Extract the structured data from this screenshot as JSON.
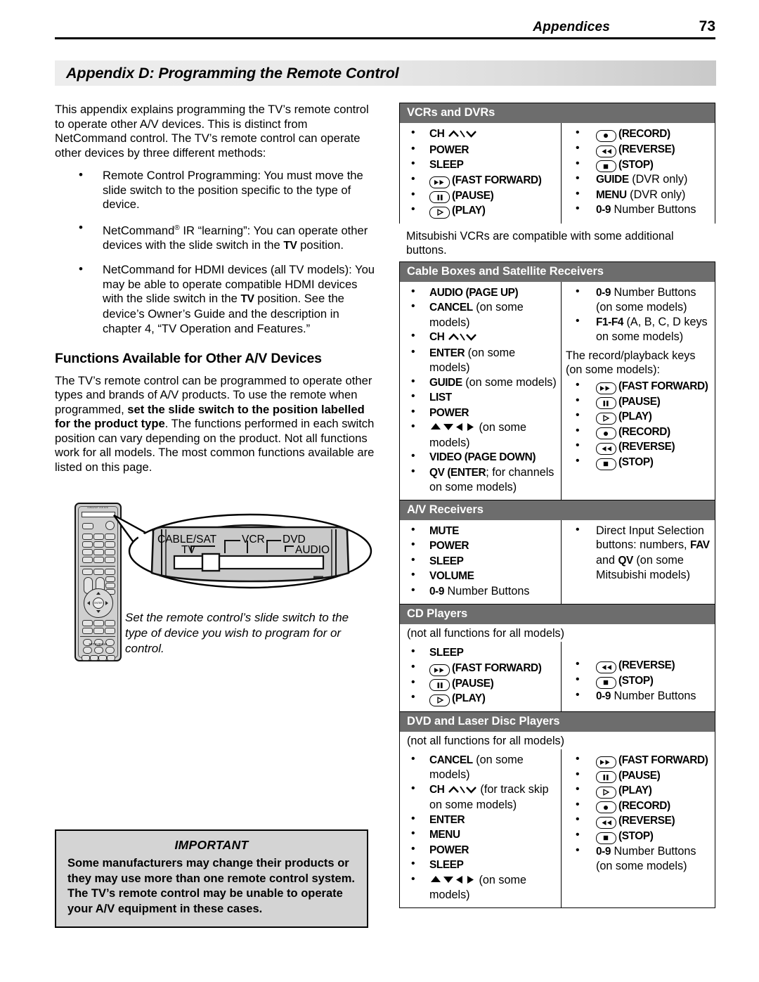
{
  "header": {
    "section_title": "Appendices",
    "page_number": "73"
  },
  "banner": {
    "title": "Appendix D:  Programming the Remote Control"
  },
  "left": {
    "intro": "This appendix explains programming the TV’s remote control to operate other A/V devices.  This is distinct from NetCommand control.  The TV’s remote control can operate other devices by three different methods:",
    "methods": [
      {
        "pre": "Remote Control Programming:  You must move the slide switch to the position specific to the type of device."
      },
      {
        "pre_a": "NetCommand",
        "reg": "®",
        "pre_b": " IR “learning”:  You can operate other devices with the slide switch in the ",
        "device": "TV",
        "post": " position."
      },
      {
        "pre_a": "NetCommand for HDMI devices (all TV models): You may be able to operate compatible HDMI devices with the slide switch in the ",
        "device": "TV",
        "post": " position. See the device’s Owner’s Guide and the description in chapter 4, “TV Operation and Features.”"
      }
    ],
    "section_heading": "Functions Available for Other A/V Devices",
    "para2_a": "The TV’s remote control can be programmed to operate other types and brands of A/V products.  To use the remote when programmed, ",
    "para2_bold": "set the slide switch to the position labelled for the product type",
    "para2_b": ".  The functions performed in each switch position can vary depending on the product.  Not all functions work for all models.  The most common functions available are listed on this page.",
    "figure": {
      "labels": {
        "cable_sat": "CABLE/SAT",
        "tv": "TV",
        "vcr": "VCR",
        "dvd": "DVD",
        "audio": "AUDIO"
      },
      "remote_slide_labels": "CABLE/SAT  VCR  DVD",
      "remote_slide_labels2": "TV  |  |  AUDIO",
      "remote_power_label": "POWER",
      "remote_brand": "MITSUBISHI",
      "caption": "Set the remote control’s slide switch to the type of device you wish to program for or control."
    },
    "important": {
      "title": "IMPORTANT",
      "body": "Some manufacturers may change their products or they may use more than one remote control system.  The TV’s remote control may be unable to operate your A/V equipment in these cases."
    }
  },
  "tables": [
    {
      "id": "vcrs-and-dvrs",
      "heading": "VCRs and DVRs",
      "col1": [
        {
          "label": "CH",
          "style": "cond",
          "suffix_icon": "ch-up-down"
        },
        {
          "label": "POWER",
          "style": "cond"
        },
        {
          "label": "SLEEP",
          "style": "cond"
        },
        {
          "icon": "fast-forward",
          "label": "(FAST FORWARD)",
          "style": "cond"
        },
        {
          "icon": "pause",
          "label": "(PAUSE)",
          "style": "cond"
        },
        {
          "icon": "play",
          "label": "(PLAY)",
          "style": "cond"
        }
      ],
      "col2": [
        {
          "icon": "record",
          "label": "(RECORD)",
          "style": "cond"
        },
        {
          "icon": "reverse",
          "label": "(REVERSE)",
          "style": "cond"
        },
        {
          "icon": "stop",
          "label": "(STOP)",
          "style": "cond"
        },
        {
          "label": "GUIDE",
          "style": "cond",
          "plain": " (DVR only)"
        },
        {
          "label": "MENU",
          "style": "cond",
          "plain": " (DVR only)"
        },
        {
          "label": "0-9",
          "style": "cond",
          "plain": " Number Buttons"
        }
      ],
      "footer_note": "Mitsubishi VCRs are compatible with some additional buttons."
    },
    {
      "id": "cable-boxes-and-satellite-receivers",
      "heading": "Cable Boxes and Satellite Receivers",
      "col1": [
        {
          "label": "AUDIO (PAGE UP)",
          "style": "cond"
        },
        {
          "label": "CANCEL",
          "style": "cond",
          "plain": " (on some models)"
        },
        {
          "label": "CH",
          "style": "cond",
          "suffix_icon": "ch-up-down"
        },
        {
          "label": "ENTER",
          "style": "cond",
          "plain": " (on some models)"
        },
        {
          "label": "GUIDE",
          "style": "cond",
          "plain": " (on some models)"
        },
        {
          "label": "LIST",
          "style": "cond"
        },
        {
          "label": "POWER",
          "style": "cond"
        },
        {
          "icon": "dpad",
          "plain": " (on some models)"
        },
        {
          "label": "VIDEO (PAGE DOWN)",
          "style": "cond"
        },
        {
          "label": "QV (ENTER",
          "style": "cond",
          "plain": "; for channels on some models)"
        }
      ],
      "col2": [
        {
          "label": "0-9",
          "style": "cond",
          "plain": " Number Buttons (on some models)"
        },
        {
          "label": "F1-F4",
          "style": "cond",
          "plain": " (A, B, C, D keys on some models)"
        }
      ],
      "col2_note": "The record/playback keys (on some models):",
      "col2_after": [
        {
          "icon": "fast-forward",
          "label": "(FAST FORWARD)",
          "style": "cond"
        },
        {
          "icon": "pause",
          "label": "(PAUSE)",
          "style": "cond"
        },
        {
          "icon": "play",
          "label": "(PLAY)",
          "style": "cond"
        },
        {
          "icon": "record",
          "label": "(RECORD)",
          "style": "cond"
        },
        {
          "icon": "reverse",
          "label": "(REVERSE)",
          "style": "cond"
        },
        {
          "icon": "stop",
          "label": "(STOP)",
          "style": "cond"
        }
      ]
    },
    {
      "id": "av-receivers",
      "heading": "A/V Receivers",
      "col1": [
        {
          "label": "MUTE",
          "style": "cond"
        },
        {
          "label": "POWER",
          "style": "cond"
        },
        {
          "label": "SLEEP",
          "style": "cond"
        },
        {
          "label": "VOLUME",
          "style": "cond"
        },
        {
          "label": "0-9",
          "style": "cond",
          "plain": " Number Buttons"
        }
      ],
      "col2": [
        {
          "plain_lead": "Direct Input Selection buttons:  numbers, ",
          "label": "FAV",
          "style": "cond",
          "plain_mid": " and ",
          "label2": "QV",
          "plain": " (on some Mitsubishi models)"
        }
      ]
    },
    {
      "id": "cd-players",
      "heading": "CD Players",
      "note": "(not all functions for all models)",
      "col1": [
        {
          "label": "SLEEP",
          "style": "cond"
        },
        {
          "icon": "fast-forward",
          "label": "(FAST FORWARD)",
          "style": "cond"
        },
        {
          "icon": "pause",
          "label": "(PAUSE)",
          "style": "cond"
        },
        {
          "icon": "play",
          "label": "(PLAY)",
          "style": "cond"
        }
      ],
      "col2": [
        {
          "icon": "reverse",
          "label": "(REVERSE)",
          "style": "cond"
        },
        {
          "icon": "stop",
          "label": "(STOP)",
          "style": "cond"
        },
        {
          "label": "0-9",
          "style": "cond",
          "plain": " Number Buttons"
        }
      ]
    },
    {
      "id": "dvd-and-laser-disc-players",
      "heading": "DVD and Laser Disc Players",
      "note": "(not all functions for all models)",
      "col1": [
        {
          "label": "CANCEL",
          "style": "cond",
          "plain": " (on some models)"
        },
        {
          "label": "CH",
          "style": "cond",
          "suffix_icon": "ch-up-down",
          "plain": " (for track skip on some models)"
        },
        {
          "label": "ENTER",
          "style": "cond"
        },
        {
          "label": "MENU",
          "style": "cond"
        },
        {
          "label": "POWER",
          "style": "cond"
        },
        {
          "label": "SLEEP",
          "style": "cond"
        },
        {
          "icon": "dpad",
          "plain": " (on some models)"
        }
      ],
      "col2": [
        {
          "icon": "fast-forward",
          "label": "(FAST FORWARD)",
          "style": "cond"
        },
        {
          "icon": "pause",
          "label": "(PAUSE)",
          "style": "cond"
        },
        {
          "icon": "play",
          "label": "(PLAY)",
          "style": "cond"
        },
        {
          "icon": "record",
          "label": "(RECORD)",
          "style": "cond"
        },
        {
          "icon": "reverse",
          "label": "(REVERSE)",
          "style": "cond"
        },
        {
          "icon": "stop",
          "label": "(STOP)",
          "style": "cond"
        },
        {
          "label": "0-9",
          "style": "cond",
          "plain": " Number Buttons (on some models)"
        }
      ]
    }
  ],
  "colors": {
    "table_header_bg": "#6d6d6d",
    "important_bg": "#d4d4d4",
    "banner_light": "#ededed",
    "banner_dark": "#c9c9c9",
    "remote_body": "#cfcfcf"
  }
}
